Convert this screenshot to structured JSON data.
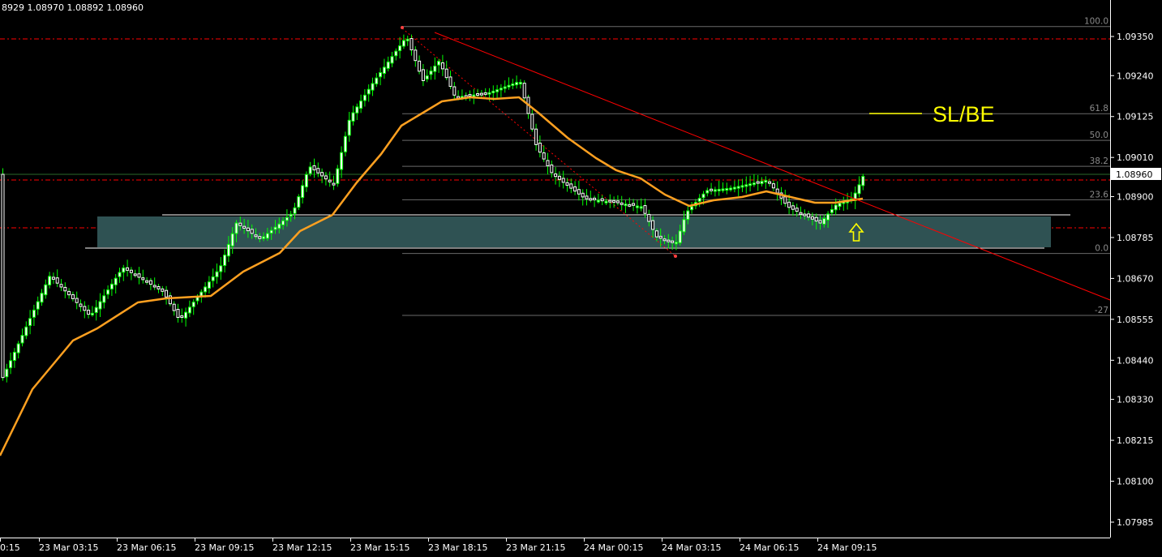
{
  "header": {
    "ohlc_text": "8929 1.08970 1.08892 1.08960"
  },
  "price_axis": {
    "labels": [
      "1.09350",
      "1.09240",
      "1.09125",
      "1.09010",
      "1.08900",
      "1.08785",
      "1.08670",
      "1.08555",
      "1.08440",
      "1.08330",
      "1.08215",
      "1.08100",
      "1.07985"
    ],
    "current_price": "1.08960"
  },
  "time_axis": {
    "labels": [
      "0:15",
      "23 Mar 03:15",
      "23 Mar 06:15",
      "23 Mar 09:15",
      "23 Mar 12:15",
      "23 Mar 15:15",
      "23 Mar 18:15",
      "23 Mar 21:15",
      "24 Mar 00:15",
      "24 Mar 03:15",
      "24 Mar 06:15",
      "24 Mar 09:15"
    ]
  },
  "fibonacci": {
    "levels": [
      {
        "label": "100.0",
        "price": 1.09378
      },
      {
        "label": "61.8",
        "price": 1.09133
      },
      {
        "label": "50.0",
        "price": 1.09058
      },
      {
        "label": "38.2",
        "price": 1.08985
      },
      {
        "label": "23.6",
        "price": 1.08891
      },
      {
        "label": "0.0",
        "price": 1.0874
      },
      {
        "label": "-27",
        "price": 1.08566
      }
    ]
  },
  "annotations": {
    "slbe_label": "SL/BE"
  },
  "colors": {
    "background": "#000000",
    "bull_candle": "#ffffff",
    "bear_candle": "#ffffff",
    "wick": "#00ff00",
    "moving_average": "#ffa020",
    "trendline": "#ff0000",
    "fib_line": "#6a6a6a",
    "zone_fill": "#2f5253",
    "grid_dash": "#ff0000",
    "arrow": "#ffff00",
    "slbe": "#ffff00"
  }
}
